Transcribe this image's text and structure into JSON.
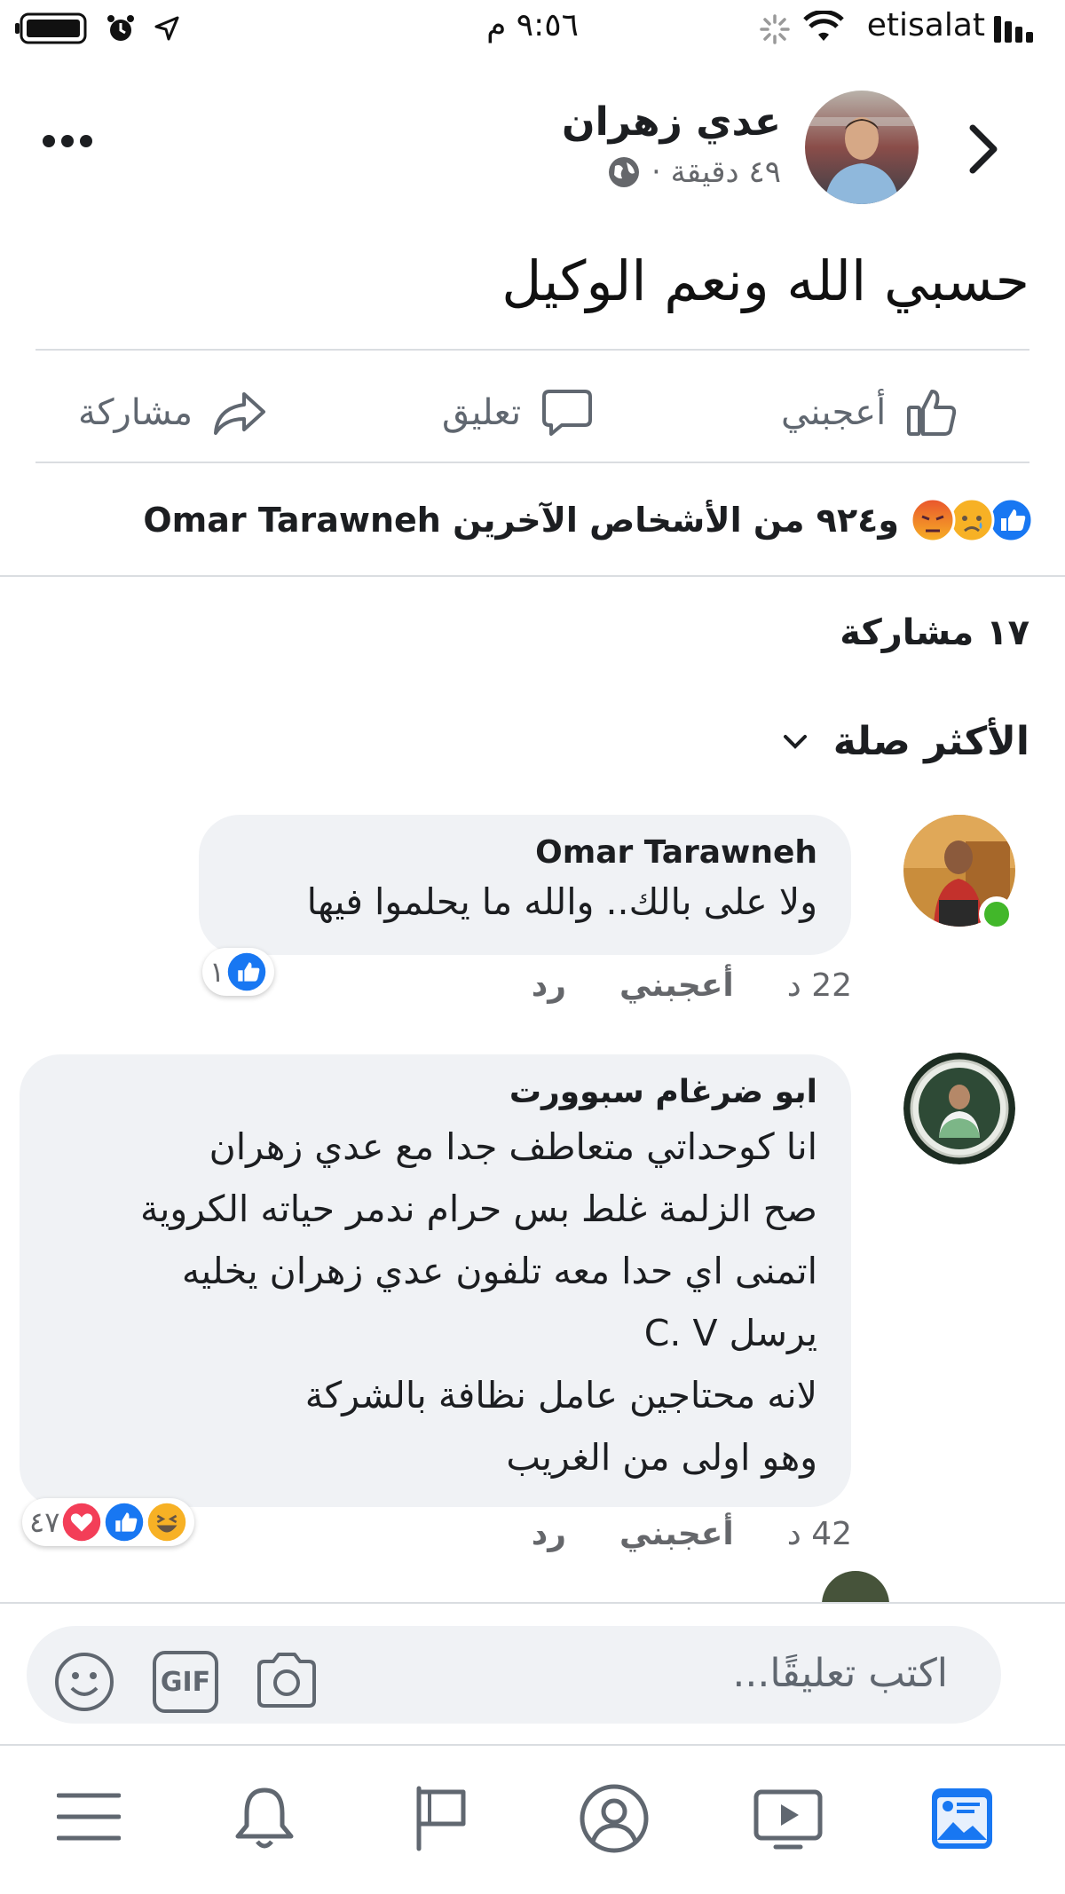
{
  "status_bar": {
    "carrier": "etisalat",
    "time": "٩:٥٦ م"
  },
  "post": {
    "author": "عدي زهران",
    "meta_time": "٤٩ دقيقة ·",
    "text": "حسبي الله ونعم الوكيل",
    "actions": {
      "like": "أعجبني",
      "comment": "تعليق",
      "share": "مشاركة"
    },
    "reactions_summary": "Omar Tarawneh و٩٢٤ من الأشخاص الآخرين",
    "share_count": "١٧ مشاركة",
    "sort_label": "الأكثر صلة"
  },
  "comments": [
    {
      "author": "Omar Tarawneh",
      "text": "ولا على بالك.. والله ما يحلموا فيها",
      "time": "22 د",
      "like": "أعجبني",
      "reply": "رد",
      "reaction_count": "١"
    },
    {
      "author": "ابو ضرغام سبوورت",
      "lines": [
        "انا كوحداتي متعاطف جدا مع عدي زهران",
        "صح الزلمة غلط بس حرام ندمر حياته الكروية",
        "اتمنى اي حدا معه تلفون عدي زهران يخليه",
        "يرسل C. V",
        "لانه محتاجين عامل نظافة بالشركة",
        "وهو اولى من الغريب"
      ],
      "time": "42 د",
      "like": "أعجبني",
      "reply": "رد",
      "reaction_count": "٤٧"
    }
  ],
  "composer": {
    "placeholder": "اكتب تعليقًا...",
    "gif_label": "GIF"
  },
  "colors": {
    "like_blue": "#1877f2",
    "online_green": "#42b72a",
    "love_red": "#f33e58",
    "haha_yellow": "#f7b125"
  },
  "icons": [
    "back-chevron-icon",
    "more-options-icon",
    "globe-icon",
    "like-icon",
    "comment-icon",
    "share-icon",
    "emoji-icon",
    "gif-icon",
    "camera-icon",
    "menu-icon",
    "bell-icon",
    "flag-icon",
    "profile-icon",
    "video-icon",
    "news-feed-icon"
  ]
}
